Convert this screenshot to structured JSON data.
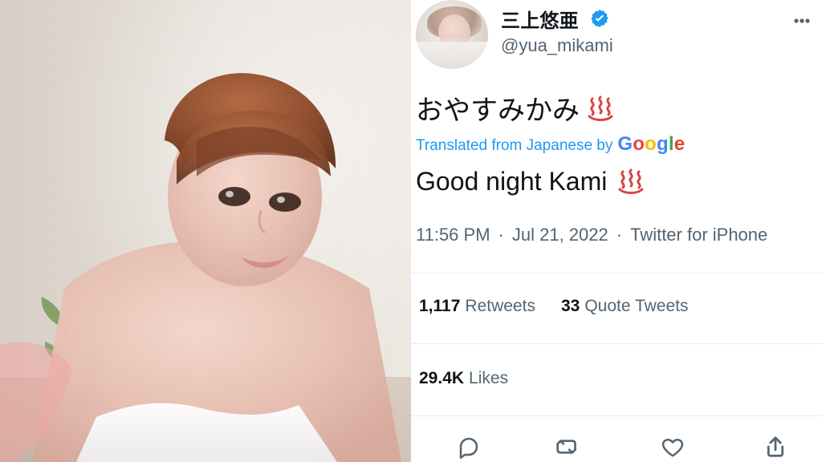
{
  "tweet": {
    "display_name": "三上悠亜",
    "handle": "@yua_mikami",
    "original_text": "おやすみかみ",
    "original_emoji": "♨",
    "translation": {
      "label": "Translated from Japanese by",
      "provider": "Google"
    },
    "translated_text": "Good night Kami",
    "translated_emoji": "♨",
    "meta": {
      "time": "11:56 PM",
      "date": "Jul 21, 2022",
      "source": "Twitter for iPhone",
      "separator": "·"
    },
    "stats": {
      "retweets": {
        "count": "1,117",
        "label": "Retweets"
      },
      "quote_tweets": {
        "count": "33",
        "label": "Quote Tweets"
      },
      "likes": {
        "count": "29.4K",
        "label": "Likes"
      }
    },
    "icons": {
      "verified": "verified-badge-icon",
      "more": "more-icon",
      "reply": "reply-icon",
      "retweet": "retweet-icon",
      "like": "like-icon",
      "share": "share-icon",
      "hot_springs": "hot-springs-icon"
    }
  },
  "colors": {
    "link_blue": "#1d9bf0",
    "text_primary": "#0f1419",
    "text_secondary": "#536471",
    "divider": "#e6ecf0",
    "hot_springs_red": "#d64545"
  }
}
